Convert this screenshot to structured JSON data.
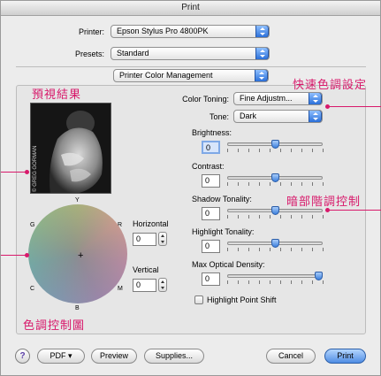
{
  "window": {
    "title": "Print"
  },
  "printer": {
    "label": "Printer:",
    "value": "Epson Stylus Pro 4800PK"
  },
  "presets": {
    "label": "Presets:",
    "value": "Standard"
  },
  "panel": {
    "value": "Printer Color Management"
  },
  "color_toning": {
    "label": "Color Toning:",
    "value": "Fine Adjustm..."
  },
  "tone": {
    "label": "Tone:",
    "value": "Dark"
  },
  "preview": {
    "watermark": "© GREG GORMAN"
  },
  "wheel": {
    "top": "Y",
    "right_top": "R",
    "left_top": "G",
    "left_bottom": "C",
    "right_bottom": "M",
    "bottom": "B",
    "center": "+"
  },
  "horizontal": {
    "label": "Horizontal",
    "value": "0"
  },
  "vertical": {
    "label": "Vertical",
    "value": "0"
  },
  "sliders": {
    "brightness": {
      "label": "Brightness:",
      "value": "0",
      "level": 0.5
    },
    "contrast": {
      "label": "Contrast:",
      "value": "0",
      "level": 0.5
    },
    "shadow_tonality": {
      "label": "Shadow Tonality:",
      "value": "0",
      "level": 0.5
    },
    "highlight_tonality": {
      "label": "Highlight Tonality:",
      "value": "0",
      "level": 0.5
    },
    "max_optical_density": {
      "label": "Max Optical Density:",
      "value": "0",
      "level": 1.0
    }
  },
  "highlight_point_shift": {
    "label": "Highlight Point Shift",
    "checked": false
  },
  "buttons": {
    "help": "?",
    "pdf": "PDF ▾",
    "preview": "Preview",
    "supplies": "Supplies...",
    "cancel": "Cancel",
    "print": "Print"
  },
  "annotations": {
    "preview_result": "預視結果",
    "quick_toning": "快速色調設定",
    "shadow_control": "暗部階調控制",
    "toning_chart": "色調控制圖"
  },
  "colors": {
    "annotation": "#d8196b",
    "accent": "#3c7fdc"
  }
}
